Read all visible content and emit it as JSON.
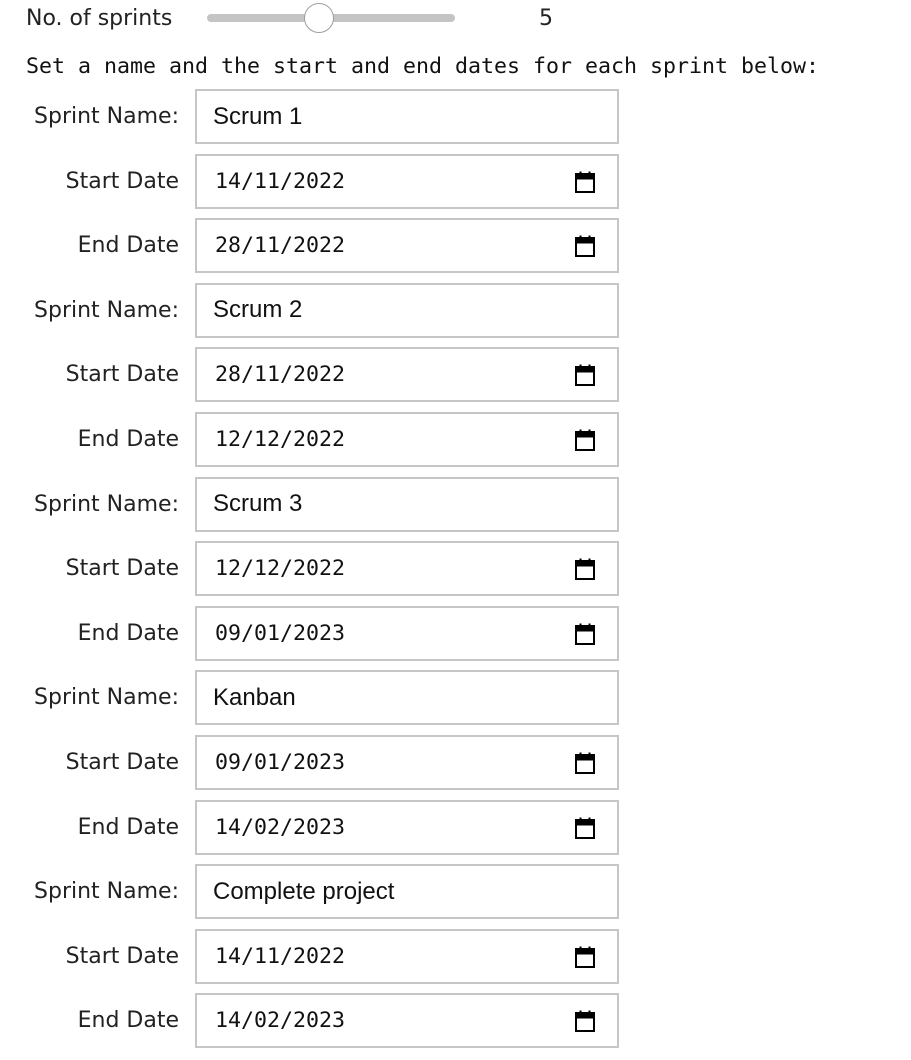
{
  "slider": {
    "label": "No. of sprints",
    "value": "5",
    "min": 1,
    "max": 10
  },
  "instructions": "Set a name and the start and end dates for each sprint below:",
  "labels": {
    "sprint_name": "Sprint Name:",
    "start_date": "Start Date",
    "end_date": "End Date"
  },
  "sprints": [
    {
      "name": "Scrum 1",
      "start": "14/11/2022",
      "end": "28/11/2022"
    },
    {
      "name": "Scrum 2",
      "start": "28/11/2022",
      "end": "12/12/2022"
    },
    {
      "name": "Scrum 3",
      "start": "12/12/2022",
      "end": "09/01/2023"
    },
    {
      "name": "Kanban",
      "start": "09/01/2023",
      "end": "14/02/2023"
    },
    {
      "name": "Complete project",
      "start": "14/11/2022",
      "end": "14/02/2023"
    }
  ],
  "icons": {
    "date_picker": "calendar-icon"
  },
  "colors": {
    "text": "#222222",
    "input_border": "#c6c6c6",
    "slider_track": "#c4c4c4",
    "slider_thumb_border": "#9e9e9e"
  }
}
